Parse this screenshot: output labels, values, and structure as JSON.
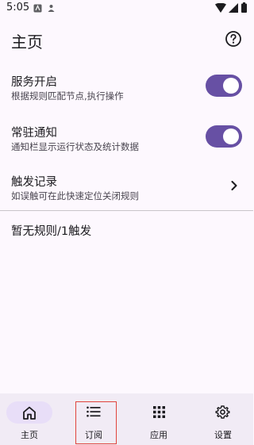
{
  "status_bar": {
    "time": "5:05"
  },
  "header": {
    "title": "主页"
  },
  "settings": [
    {
      "title": "服务开启",
      "subtitle": "根据规则匹配节点,执行操作",
      "enabled": true
    },
    {
      "title": "常驻通知",
      "subtitle": "通知栏显示运行状态及统计数据",
      "enabled": true
    },
    {
      "title": "触发记录",
      "subtitle": "如误触可在此快速定位关闭规则"
    }
  ],
  "summary": {
    "text": "暂无规则/1触发"
  },
  "bottom_nav": {
    "items": [
      {
        "label": "主页",
        "icon": "home-icon",
        "selected": true
      },
      {
        "label": "订阅",
        "icon": "list-icon",
        "selected": false
      },
      {
        "label": "应用",
        "icon": "apps-grid-icon",
        "selected": false
      },
      {
        "label": "设置",
        "icon": "gear-icon",
        "selected": false
      }
    ]
  },
  "colors": {
    "accent": "#6750a4",
    "nav_background": "#f1ebf5",
    "nav_selected": "#e8def8",
    "highlight": "#e0443c"
  }
}
